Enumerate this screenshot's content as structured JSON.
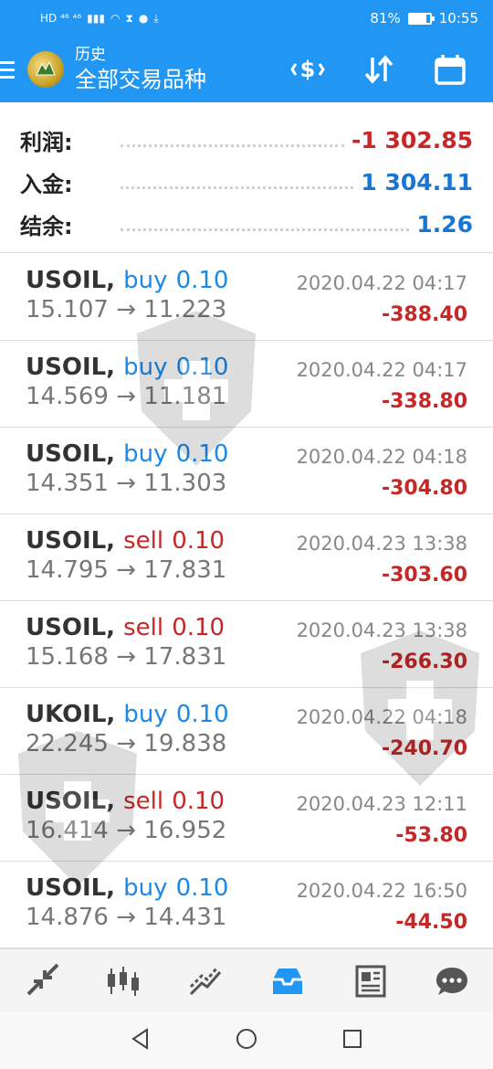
{
  "status_bar": {
    "left": "HD ⁴⁶ ⁴⁶",
    "battery": "81%",
    "battery_level": 0.81,
    "time": "10:55"
  },
  "app_bar": {
    "subtitle": "历史",
    "title": "全部交易品种"
  },
  "summary": [
    {
      "label": "利润:",
      "value": "-1 302.85",
      "tone": "neg"
    },
    {
      "label": "入金:",
      "value": "1 304.11",
      "tone": "pos"
    },
    {
      "label": "结余:",
      "value": "1.26",
      "tone": "pos"
    }
  ],
  "trades": [
    {
      "symbol": "USOIL,",
      "side": "buy",
      "lots": "0.10",
      "open": "15.107",
      "close": "11.223",
      "time": "2020.04.22 04:17",
      "profit": "-388.40"
    },
    {
      "symbol": "USOIL,",
      "side": "buy",
      "lots": "0.10",
      "open": "14.569",
      "close": "11.181",
      "time": "2020.04.22 04:17",
      "profit": "-338.80"
    },
    {
      "symbol": "USOIL,",
      "side": "buy",
      "lots": "0.10",
      "open": "14.351",
      "close": "11.303",
      "time": "2020.04.22 04:18",
      "profit": "-304.80"
    },
    {
      "symbol": "USOIL,",
      "side": "sell",
      "lots": "0.10",
      "open": "14.795",
      "close": "17.831",
      "time": "2020.04.23 13:38",
      "profit": "-303.60"
    },
    {
      "symbol": "USOIL,",
      "side": "sell",
      "lots": "0.10",
      "open": "15.168",
      "close": "17.831",
      "time": "2020.04.23 13:38",
      "profit": "-266.30"
    },
    {
      "symbol": "UKOIL,",
      "side": "buy",
      "lots": "0.10",
      "open": "22.245",
      "close": "19.838",
      "time": "2020.04.22 04:18",
      "profit": "-240.70"
    },
    {
      "symbol": "USOIL,",
      "side": "sell",
      "lots": "0.10",
      "open": "16.414",
      "close": "16.952",
      "time": "2020.04.23 12:11",
      "profit": "-53.80"
    },
    {
      "symbol": "USOIL,",
      "side": "buy",
      "lots": "0.10",
      "open": "14.876",
      "close": "14.431",
      "time": "2020.04.22 16:50",
      "profit": "-44.50"
    }
  ],
  "arrow": "→",
  "bottom_nav": [
    {
      "name": "quotes-icon",
      "active": false
    },
    {
      "name": "chart-icon",
      "active": false
    },
    {
      "name": "trade-icon",
      "active": false
    },
    {
      "name": "history-icon",
      "active": true
    },
    {
      "name": "news-icon",
      "active": false
    },
    {
      "name": "chat-icon",
      "active": false
    }
  ],
  "colors": {
    "accent": "#2196f3",
    "negative": "#c62828",
    "positive": "#1976d2",
    "buy": "#1e88e5",
    "sell": "#c62828"
  }
}
